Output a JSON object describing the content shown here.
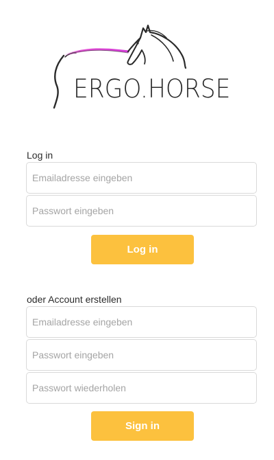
{
  "brand": {
    "name": "ERGO.HORSE",
    "accent_color": "#e040d0",
    "icon": "horse-head-logo"
  },
  "login": {
    "heading": "Log in",
    "email_placeholder": "Emailadresse eingeben",
    "password_placeholder": "Passwort eingeben",
    "button_label": "Log in"
  },
  "register": {
    "heading": "oder Account erstellen",
    "email_placeholder": "Emailadresse eingeben",
    "password_placeholder": "Passwort eingeben",
    "password_repeat_placeholder": "Passwort wiederholen",
    "button_label": "Sign in"
  },
  "colors": {
    "button": "#fcc13e",
    "field_border": "#d9d9d9",
    "placeholder": "#a4a4a4"
  }
}
